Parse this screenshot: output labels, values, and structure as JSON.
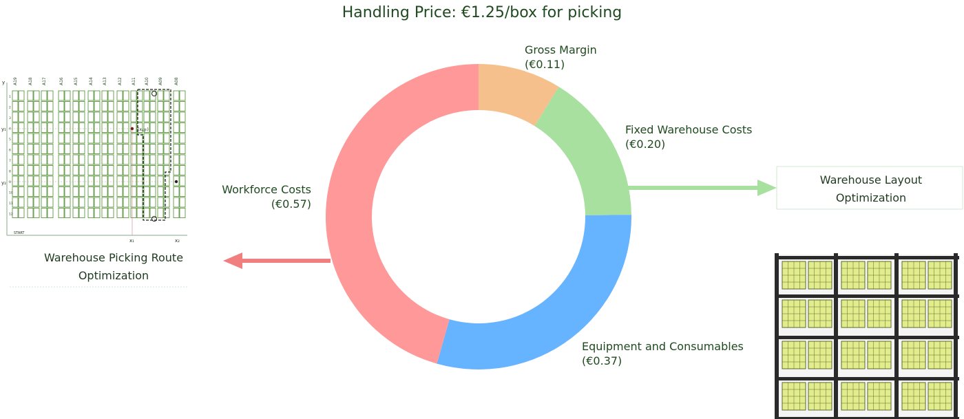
{
  "title": "Handling Price: €1.25/box for picking",
  "chart_data": {
    "type": "pie",
    "variant": "donut",
    "title": "Handling Price: €1.25/box for picking",
    "total": 1.25,
    "slices": [
      {
        "name": "Gross Margin",
        "value": 0.11,
        "value_label": "(€0.11)",
        "color": "#f5c08c"
      },
      {
        "name": "Fixed Warehouse Costs",
        "value": 0.2,
        "value_label": "(€0.20)",
        "color": "#a8e0a0"
      },
      {
        "name": "Equipment and Consumables",
        "value": 0.37,
        "value_label": "(€0.37)",
        "color": "#66b3ff"
      },
      {
        "name": "Workforce Costs",
        "value": 0.57,
        "value_label": "(€0.57)",
        "color": "#ff9999"
      }
    ],
    "start_angle_deg": 90,
    "direction": "clockwise"
  },
  "annotations": {
    "left_box": {
      "line1": "Warehouse Picking Route",
      "line2": "Optimization",
      "arrow_color": "#f08080"
    },
    "right_box": {
      "line1": "Warehouse Layout",
      "line2": "Optimization",
      "arrow_color": "#a8e0a0"
    }
  },
  "grid_image": {
    "column_labels": [
      "A19",
      "A18",
      "A17",
      "A16",
      "A15",
      "A14",
      "A13",
      "A12",
      "A11",
      "A10",
      "A09",
      "A08"
    ],
    "row_labels": [
      "1",
      "2",
      "3",
      "4",
      "5",
      "6",
      "7",
      "8",
      "9",
      "10",
      "11",
      "12"
    ],
    "axis_labels": {
      "y": "y",
      "y1": "y₁",
      "y2": "y₂",
      "x1": "x₁",
      "x2": "x₂",
      "start": "START",
      "point": "(xᵢ,yᵢ)"
    }
  }
}
